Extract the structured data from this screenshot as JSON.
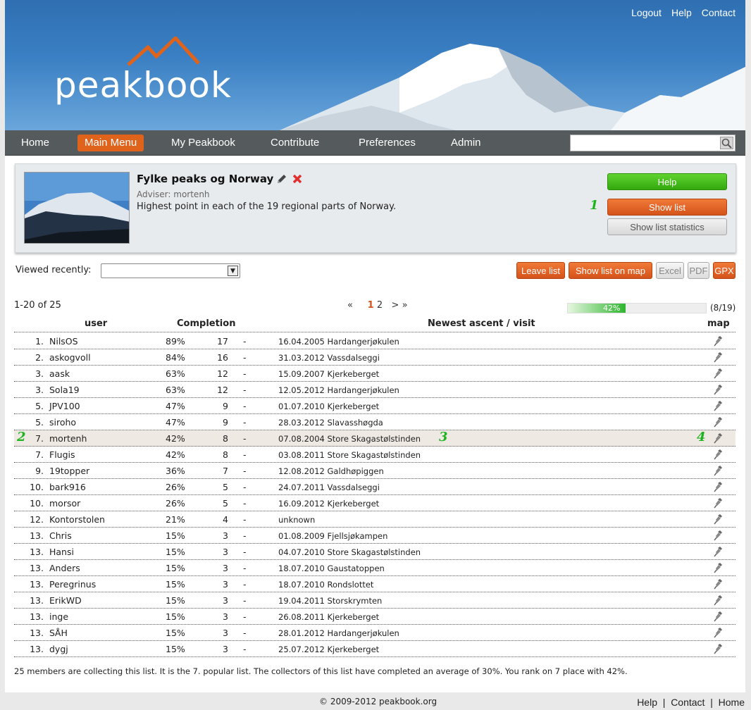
{
  "header": {
    "logo_text": "peakbook",
    "top_links": [
      "Logout",
      "Help",
      "Contact"
    ]
  },
  "nav": {
    "items": [
      "Home",
      "Main Menu",
      "My Peakbook",
      "Contribute",
      "Preferences",
      "Admin"
    ],
    "active": "Main Menu",
    "search_value": ""
  },
  "list_info": {
    "title": "Fylke peaks og Norway",
    "adviser": "Adviser: mortenh",
    "description": "Highest point in each of the 19 regional parts of Norway.",
    "buttons": {
      "help": "Help",
      "show_list": "Show list",
      "show_stats": "Show list statistics"
    }
  },
  "markers": [
    "1",
    "2",
    "3",
    "4"
  ],
  "viewed_recently": {
    "label": "Viewed recently:",
    "value": ""
  },
  "actions": {
    "leave": "Leave list",
    "map": "Show list on map",
    "excel": "Excel",
    "pdf": "PDF",
    "gpx": "GPX"
  },
  "pager": {
    "range": "1-20 of 25",
    "first": "«",
    "pages": [
      "1",
      "2"
    ],
    "current": "1",
    "next": ">",
    "last": "»",
    "progress_pct": 42,
    "progress_label": "42%",
    "progress_count": "(8/19)"
  },
  "table": {
    "headers": {
      "user": "user",
      "completion": "Completion",
      "newest": "Newest ascent / visit",
      "map": "map"
    },
    "rows": [
      {
        "rank": "1.",
        "user": "NilsOS",
        "pct": "89%",
        "count": "17",
        "dash": "-",
        "ascent": "16.04.2005 Hardangerjøkulen"
      },
      {
        "rank": "2.",
        "user": "askogvoll",
        "pct": "84%",
        "count": "16",
        "dash": "-",
        "ascent": "31.03.2012 Vassdalseggi"
      },
      {
        "rank": "3.",
        "user": "aask",
        "pct": "63%",
        "count": "12",
        "dash": "-",
        "ascent": "15.09.2007 Kjerkeberget"
      },
      {
        "rank": "3.",
        "user": "Sola19",
        "pct": "63%",
        "count": "12",
        "dash": "-",
        "ascent": "12.05.2012 Hardangerjøkulen"
      },
      {
        "rank": "5.",
        "user": "JPV100",
        "pct": "47%",
        "count": "9",
        "dash": "-",
        "ascent": "01.07.2010 Kjerkeberget"
      },
      {
        "rank": "5.",
        "user": "siroho",
        "pct": "47%",
        "count": "9",
        "dash": "-",
        "ascent": "28.03.2012 Slavasshøgda"
      },
      {
        "rank": "7.",
        "user": "mortenh",
        "pct": "42%",
        "count": "8",
        "dash": "-",
        "ascent": "07.08.2004 Store Skagastølstinden"
      },
      {
        "rank": "7.",
        "user": "Flugis",
        "pct": "42%",
        "count": "8",
        "dash": "-",
        "ascent": "03.08.2011 Store Skagastølstinden"
      },
      {
        "rank": "9.",
        "user": "19topper",
        "pct": "36%",
        "count": "7",
        "dash": "-",
        "ascent": "12.08.2012 Galdhøpiggen"
      },
      {
        "rank": "10.",
        "user": "bark916",
        "pct": "26%",
        "count": "5",
        "dash": "-",
        "ascent": "24.07.2011 Vassdalseggi"
      },
      {
        "rank": "10.",
        "user": "morsor",
        "pct": "26%",
        "count": "5",
        "dash": "-",
        "ascent": "16.09.2012 Kjerkeberget"
      },
      {
        "rank": "12.",
        "user": "Kontorstolen",
        "pct": "21%",
        "count": "4",
        "dash": "-",
        "ascent": "unknown"
      },
      {
        "rank": "13.",
        "user": "Chris",
        "pct": "15%",
        "count": "3",
        "dash": "-",
        "ascent": "01.08.2009 Fjellsjøkampen"
      },
      {
        "rank": "13.",
        "user": "Hansi",
        "pct": "15%",
        "count": "3",
        "dash": "-",
        "ascent": "04.07.2010 Store Skagastølstinden"
      },
      {
        "rank": "13.",
        "user": "Anders",
        "pct": "15%",
        "count": "3",
        "dash": "-",
        "ascent": "18.07.2010 Gaustatoppen"
      },
      {
        "rank": "13.",
        "user": "Peregrinus",
        "pct": "15%",
        "count": "3",
        "dash": "-",
        "ascent": "18.07.2010 Rondslottet"
      },
      {
        "rank": "13.",
        "user": "ErikWD",
        "pct": "15%",
        "count": "3",
        "dash": "-",
        "ascent": "19.04.2011 Storskrymten"
      },
      {
        "rank": "13.",
        "user": "inge",
        "pct": "15%",
        "count": "3",
        "dash": "-",
        "ascent": "26.08.2011 Kjerkeberget"
      },
      {
        "rank": "13.",
        "user": "SÅH",
        "pct": "15%",
        "count": "3",
        "dash": "-",
        "ascent": "28.01.2012 Hardangerjøkulen"
      },
      {
        "rank": "13.",
        "user": "dygj",
        "pct": "15%",
        "count": "3",
        "dash": "-",
        "ascent": "25.07.2012 Kjerkeberget"
      }
    ],
    "highlighted_user": "mortenh"
  },
  "summary": "25 members are collecting this list. It is the 7. popular list. The collectors of this list have completed an average of 30%. You rank on 7 place with 42%.",
  "footer": {
    "copyright": "© 2009-2012 peakbook.org",
    "links": [
      "Help",
      "Contact",
      "Home"
    ],
    "separator": "|"
  },
  "colors": {
    "accent": "#e0631c",
    "nav_bg": "#555a5c",
    "success": "#33a80d",
    "marker": "#1fb31f"
  },
  "icons": {
    "edit": "pencil-icon",
    "delete": "delete-icon",
    "search": "search-icon",
    "map": "map-pin-icon"
  }
}
